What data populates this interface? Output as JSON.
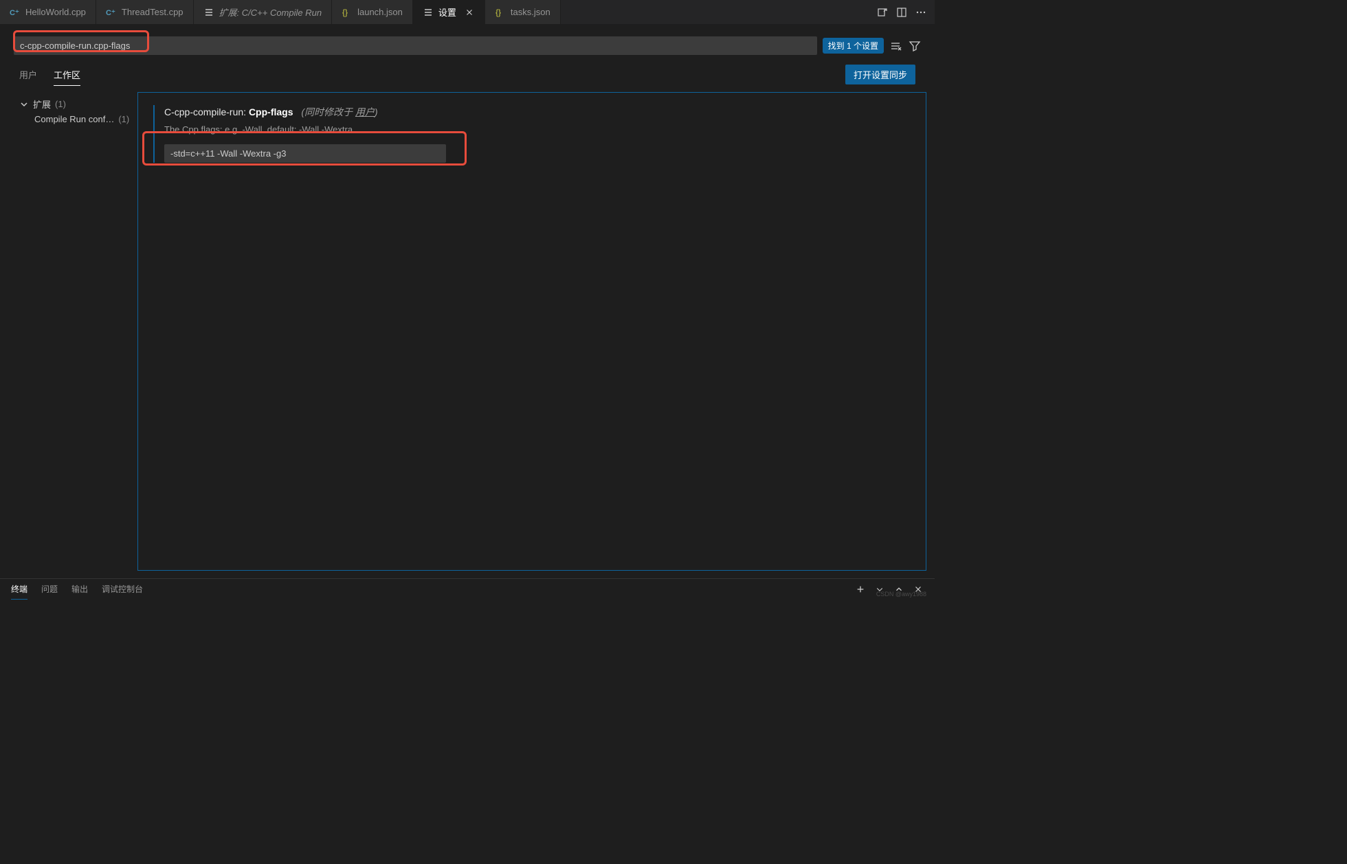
{
  "tabs": [
    {
      "label": "HelloWorld.cpp",
      "icon": "cpp",
      "italic": false
    },
    {
      "label": "ThreadTest.cpp",
      "icon": "cpp",
      "italic": false
    },
    {
      "label": "扩展: C/C++ Compile Run",
      "icon": "list",
      "italic": true
    },
    {
      "label": "launch.json",
      "icon": "json",
      "italic": false
    },
    {
      "label": "设置",
      "icon": "settings",
      "italic": false,
      "active": true,
      "closable": true
    },
    {
      "label": "tasks.json",
      "icon": "json",
      "italic": false
    }
  ],
  "search": {
    "value": "c-cpp-compile-run.cpp-flags",
    "result_badge": "找到 1 个设置"
  },
  "scope": {
    "user": "用户",
    "workspace": "工作区",
    "sync_button": "打开设置同步"
  },
  "sidebar": {
    "category": "扩展",
    "category_count": "(1)",
    "item": "Compile Run conf…",
    "item_count": "(1)"
  },
  "setting": {
    "prefix": "C-cpp-compile-run:",
    "name": "Cpp-flags",
    "meta_prefix": "(同时修改于 ",
    "meta_link": "用户",
    "meta_suffix": ")",
    "description": "The Cpp flags: e.g. -Wall. default: -Wall -Wextra",
    "value": "-std=c++11 -Wall -Wextra -g3"
  },
  "panel": {
    "terminal": "终端",
    "problems": "问题",
    "output": "输出",
    "debug": "调试控制台"
  },
  "watermark": "CSDN @awy1988"
}
